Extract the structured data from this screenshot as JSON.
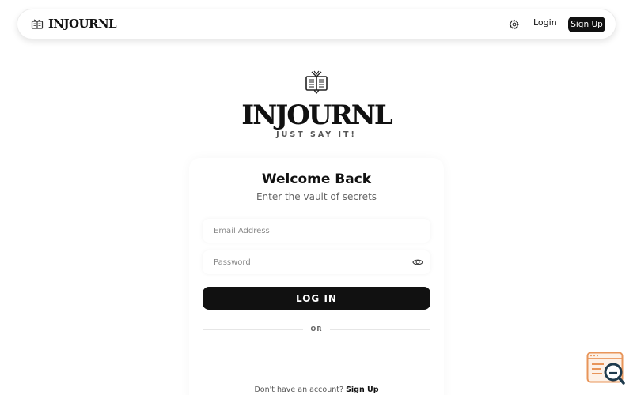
{
  "navbar": {
    "brand": "INJOURNL",
    "login_label": "Login",
    "signup_label": "Sign Up",
    "logo_icon": "book-icon",
    "settings_icon": "gear-icon"
  },
  "hero": {
    "title": "INJOURNL",
    "tagline": "JUST SAY IT!",
    "logo_icon": "open-book-icon"
  },
  "login_card": {
    "title": "Welcome Back",
    "subtitle": "Enter the vault of secrets",
    "email": {
      "placeholder": "Email Address",
      "value": ""
    },
    "password": {
      "placeholder": "Password",
      "value": "",
      "toggle_icon": "eye-icon"
    },
    "submit_label": "LOG IN",
    "divider_label": "OR",
    "footer_prompt": "Don't have an account?",
    "footer_link": "Sign Up"
  },
  "widget": {
    "icon": "search-report-icon"
  },
  "colors": {
    "primary": "#111111",
    "background": "#ffffff",
    "muted_text": "#666666",
    "widget_accent": "#e8955a",
    "widget_dark": "#1f3b4d"
  }
}
